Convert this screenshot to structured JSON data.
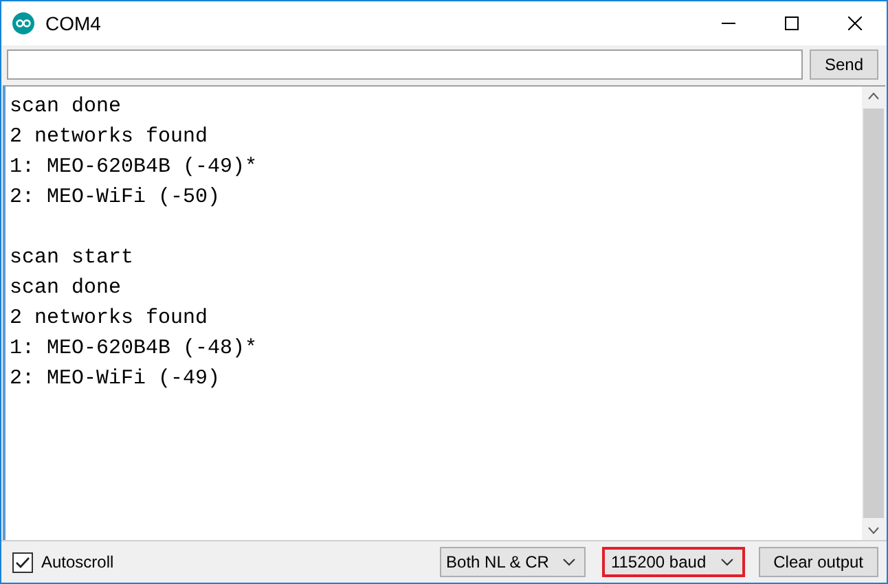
{
  "window": {
    "title": "COM4"
  },
  "input": {
    "button": "Send"
  },
  "output": {
    "blocks": [
      {
        "lines": [
          "scan done",
          "2 networks found",
          "1: MEO-620B4B (-49)*",
          "2: MEO-WiFi (-50)"
        ]
      },
      {
        "lines": [
          "scan start",
          "scan done",
          "2 networks found",
          "1: MEO-620B4B (-48)*",
          "2: MEO-WiFi (-49)"
        ]
      }
    ]
  },
  "footer": {
    "autoscroll": {
      "label": "Autoscroll",
      "checked": true
    },
    "dropdowns": [
      {
        "value": "Both NL & CR",
        "highlighted": false
      },
      {
        "value": "115200 baud",
        "highlighted": true
      }
    ],
    "button": "Clear output"
  }
}
